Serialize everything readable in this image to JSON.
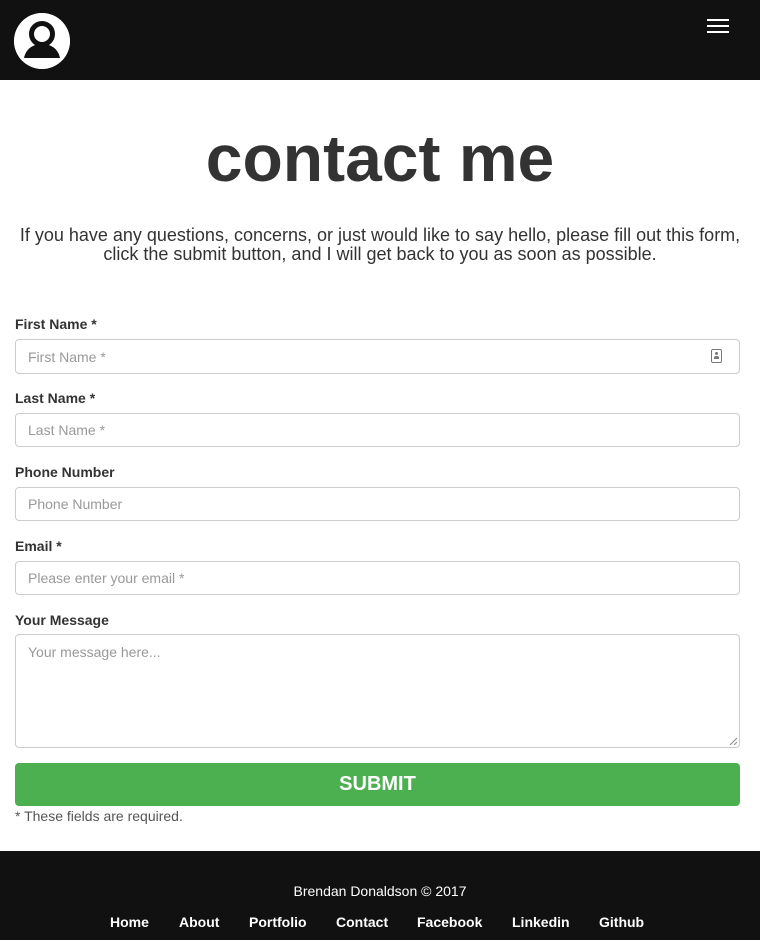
{
  "header": {
    "avatar_icon": "user-avatar-icon",
    "menu_icon": "hamburger-menu-icon"
  },
  "page": {
    "title": "contact me",
    "intro": "If you have any questions, concerns, or just would like to say hello, please fill out this form, click the submit button, and I will get back to you as soon as possible."
  },
  "form": {
    "first_name": {
      "label": "First Name *",
      "placeholder": "First Name *",
      "value": ""
    },
    "last_name": {
      "label": "Last Name *",
      "placeholder": "Last Name *",
      "value": ""
    },
    "phone": {
      "label": "Phone Number",
      "placeholder": "Phone Number",
      "value": ""
    },
    "email": {
      "label": "Email *",
      "placeholder": "Please enter your email *",
      "value": ""
    },
    "message": {
      "label": "Your Message",
      "placeholder": "Your message here...",
      "value": ""
    },
    "submit_label": "SUBMIT",
    "required_note": "* These fields are required."
  },
  "footer": {
    "copyright": "Brendan Donaldson © 2017",
    "links": [
      "Home",
      "About",
      "Portfolio",
      "Contact",
      "Facebook",
      "Linkedin",
      "Github"
    ]
  },
  "colors": {
    "nav_background": "#111111",
    "submit_green": "#4caf50",
    "text": "#333333"
  }
}
